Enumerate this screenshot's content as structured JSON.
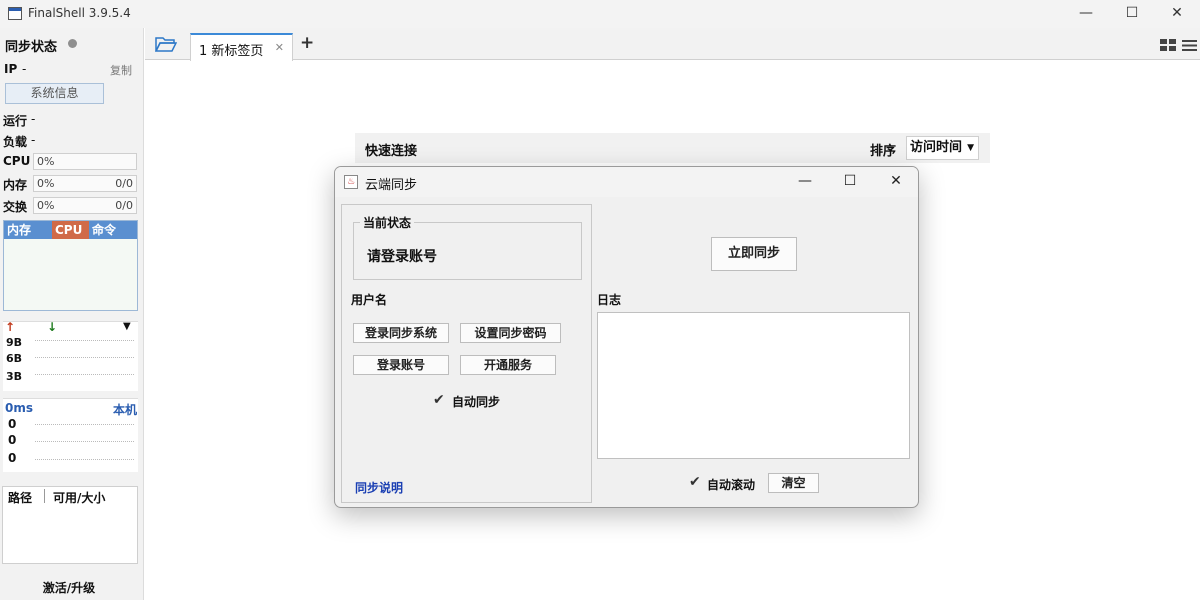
{
  "window": {
    "title": "FinalShell 3.9.5.4",
    "minimize": "—",
    "maximize": "☐",
    "close": "✕"
  },
  "sidebar": {
    "sync_status_label": "同步状态",
    "ip_label": "IP",
    "ip_value": "-",
    "copy_label": "复制",
    "sysinfo_button": "系统信息",
    "run_label": "运行",
    "run_value": "-",
    "load_label": "负载",
    "load_value": "-",
    "cpu_label": "CPU",
    "cpu_value": "0%",
    "mem_label": "内存",
    "mem_value": "0%",
    "mem_right": "0/0",
    "swap_label": "交换",
    "swap_value": "0%",
    "swap_right": "0/0",
    "monitor_tabs": [
      {
        "label": "内存",
        "color": "#5a8fd0"
      },
      {
        "label": "CPU",
        "color": "#d06a48"
      },
      {
        "label": "命令",
        "color": "#5a8fd0"
      }
    ],
    "net_up_icon": "↑",
    "net_down_icon": "↓",
    "net_menu_icon": "▼",
    "net_ticks": [
      "9B",
      "6B",
      "3B"
    ],
    "ping_label": "0ms",
    "ping_target": "本机",
    "ping_ticks": [
      "0",
      "0",
      "0"
    ],
    "disk_col_path": "路径",
    "disk_col_size": "可用/大小",
    "activate_label": "激活/升级"
  },
  "tabs": {
    "folder_icon": "folder-open",
    "active_tab_label": "1 新标签页",
    "add_tab": "+"
  },
  "quick": {
    "label": "快速连接",
    "sort_label": "排序",
    "sort_value": "访问时间"
  },
  "dialog": {
    "title": "云端同步",
    "current_status_legend": "当前状态",
    "status_text": "请登录账号",
    "username_label": "用户名",
    "btn_login_sync": "登录同步系统",
    "btn_set_password": "设置同步密码",
    "btn_login_account": "登录账号",
    "btn_open_service": "开通服务",
    "auto_sync_label": "自动同步",
    "sync_help_link": "同步说明",
    "btn_sync_now": "立即同步",
    "log_label": "日志",
    "auto_scroll_label": "自动滚动",
    "btn_clear": "清空"
  }
}
